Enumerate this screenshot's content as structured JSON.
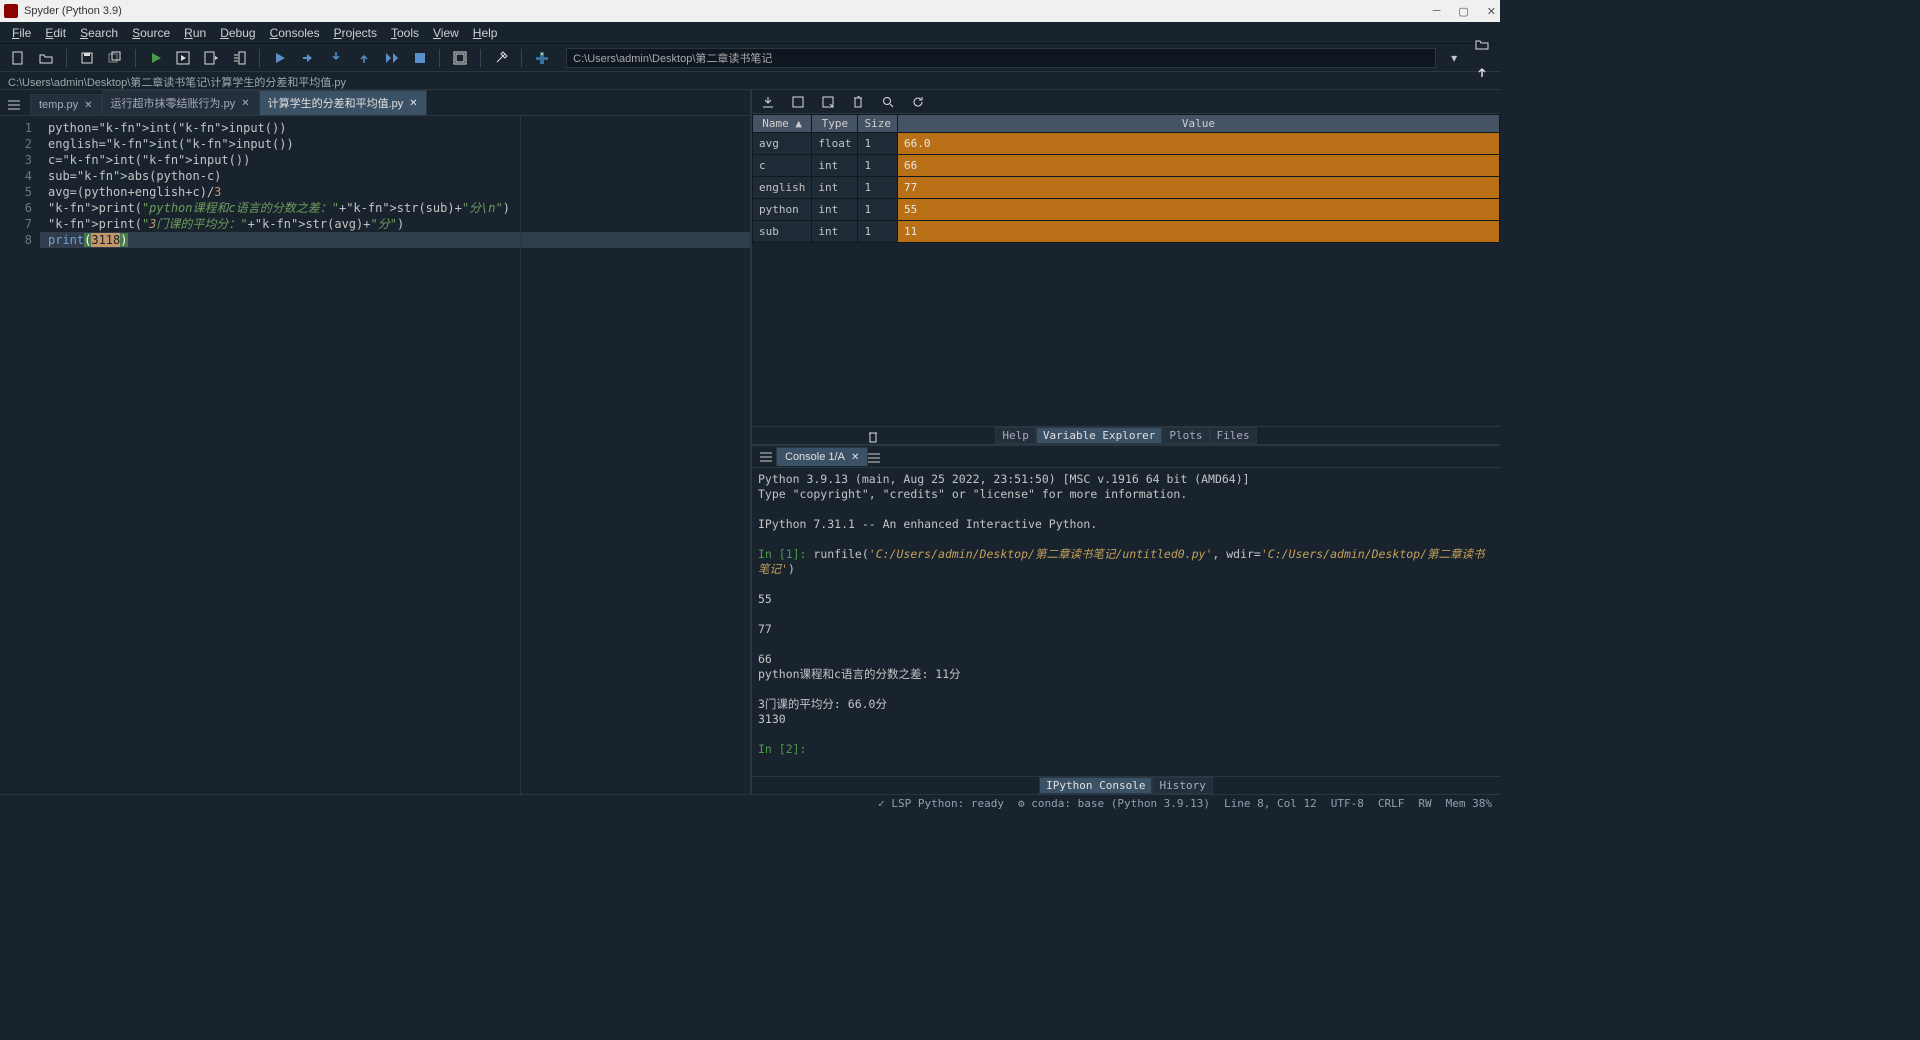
{
  "title": "Spyder (Python 3.9)",
  "menu": [
    "File",
    "Edit",
    "Search",
    "Source",
    "Run",
    "Debug",
    "Consoles",
    "Projects",
    "Tools",
    "View",
    "Help"
  ],
  "working_dir": "C:\\Users\\admin\\Desktop\\第二章读书笔记",
  "current_file": "C:\\Users\\admin\\Desktop\\第二章读书笔记\\计算学生的分差和平均值.py",
  "editor_tabs": [
    {
      "label": "temp.py",
      "active": false
    },
    {
      "label": "运行超市抹零结账行为.py",
      "active": false
    },
    {
      "label": "计算学生的分差和平均值.py",
      "active": true
    }
  ],
  "code_lines": [
    "python=int(input())",
    "english=int(input())",
    "c=int(input())",
    "sub=abs(python-c)",
    "avg=(python+english+c)/3",
    "print(\"python课程和c语言的分数之差：\"+str(sub)+\"分\\n\")",
    "print(\"3门课的平均分：\"+str(avg)+\"分\")",
    "print(3118)"
  ],
  "cursor_line": 8,
  "var_headers": [
    "Name",
    "Type",
    "Size",
    "Value"
  ],
  "vars": [
    {
      "name": "avg",
      "type": "float",
      "size": "1",
      "value": "66.0"
    },
    {
      "name": "c",
      "type": "int",
      "size": "1",
      "value": "66"
    },
    {
      "name": "english",
      "type": "int",
      "size": "1",
      "value": "77"
    },
    {
      "name": "python",
      "type": "int",
      "size": "1",
      "value": "55"
    },
    {
      "name": "sub",
      "type": "int",
      "size": "1",
      "value": "11"
    }
  ],
  "vx_tabs": [
    "Help",
    "Variable Explorer",
    "Plots",
    "Files"
  ],
  "vx_active": 1,
  "console_tab": "Console 1/A",
  "console_lines": [
    {
      "t": "plain",
      "s": "Python 3.9.13 (main, Aug 25 2022, 23:51:50) [MSC v.1916 64 bit (AMD64)]"
    },
    {
      "t": "plain",
      "s": "Type \"copyright\", \"credits\" or \"license\" for more information."
    },
    {
      "t": "blank",
      "s": ""
    },
    {
      "t": "plain",
      "s": "IPython 7.31.1 -- An enhanced Interactive Python."
    },
    {
      "t": "blank",
      "s": ""
    },
    {
      "t": "in",
      "n": "1",
      "cmd": "runfile(",
      "p1": "'C:/Users/admin/Desktop/第二章读书笔记/untitled0.py'",
      "mid": ", wdir=",
      "p2": "'C:/Users/admin/Desktop/第二章读书笔记'",
      "end": ")"
    },
    {
      "t": "blank",
      "s": ""
    },
    {
      "t": "plain",
      "s": "55"
    },
    {
      "t": "blank",
      "s": ""
    },
    {
      "t": "plain",
      "s": "77"
    },
    {
      "t": "blank",
      "s": ""
    },
    {
      "t": "plain",
      "s": "66"
    },
    {
      "t": "plain",
      "s": "python课程和c语言的分数之差: 11分"
    },
    {
      "t": "blank",
      "s": ""
    },
    {
      "t": "plain",
      "s": "3门课的平均分: 66.0分"
    },
    {
      "t": "plain",
      "s": "3130"
    },
    {
      "t": "blank",
      "s": ""
    },
    {
      "t": "in-empty",
      "n": "2"
    }
  ],
  "con_tabs": [
    "IPython Console",
    "History"
  ],
  "con_active": 0,
  "status": {
    "lsp": "LSP Python: ready",
    "conda": "conda: base (Python 3.9.13)",
    "pos": "Line 8, Col 12",
    "enc": "UTF-8",
    "eol": "CRLF",
    "rw": "RW",
    "mem": "Mem 38%"
  }
}
